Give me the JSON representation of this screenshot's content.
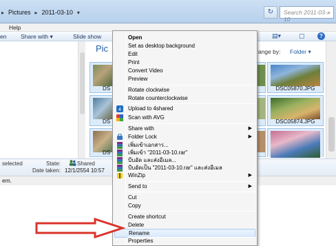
{
  "address": {
    "back_glyph": "▸",
    "crumbs": [
      "Pictures",
      "2011-03-10"
    ],
    "refresh_glyph": "↻",
    "search_placeholder": "Search 2011-03-10"
  },
  "menubar": {
    "help": "Help"
  },
  "toolbar": {
    "first_item": "en",
    "share_with": "Share with",
    "slide_show": "Slide show",
    "chevron": "▾"
  },
  "content": {
    "library_title_partial": "Pic",
    "arrange_label": "range by:",
    "arrange_value": "Folder",
    "thumbnails": [
      {
        "caption": "DS"
      },
      {
        "caption": "DS"
      },
      {
        "caption": "DS"
      },
      {
        "caption": "DSC05870.JPG"
      },
      {
        "caption": "DSC05874.JPG"
      },
      {
        "caption": ""
      }
    ]
  },
  "details": {
    "selected_text": "selected",
    "state_label": "State:",
    "state_value": "Shared",
    "date_label": "Date taken:",
    "date_value": "12/1/2554 10:57"
  },
  "status": {
    "text": "em."
  },
  "context_menu": {
    "items": [
      {
        "label": "Open",
        "bold": true
      },
      {
        "label": "Set as desktop background"
      },
      {
        "label": "Edit"
      },
      {
        "label": "Print"
      },
      {
        "label": "Convert Video"
      },
      {
        "label": "Preview"
      },
      {
        "label": "Rotate clockwise"
      },
      {
        "label": "Rotate counterclockwise"
      },
      {
        "label": "Upload to 4shared"
      },
      {
        "label": "Scan with AVG"
      },
      {
        "label": "Share with",
        "submenu": true
      },
      {
        "label": "Folder Lock",
        "submenu": true
      },
      {
        "label": "เพิ่มเข้าเอกสาร..."
      },
      {
        "label": "เพิ่มเข้า \"2011-03-10.rar\""
      },
      {
        "label": "บีบอัด และส่งอีเมล..."
      },
      {
        "label": "บีบอัดเป็น \"2011-03-10.rar\" และส่งอีเมล"
      },
      {
        "label": "WinZip",
        "submenu": true
      },
      {
        "label": "Send to",
        "submenu": true
      },
      {
        "label": "Cut"
      },
      {
        "label": "Copy"
      },
      {
        "label": "Create shortcut"
      },
      {
        "label": "Delete"
      },
      {
        "label": "Rename",
        "highlighted": true
      },
      {
        "label": "Properties"
      }
    ],
    "submenu_glyph": "▶"
  },
  "colors": {
    "accent_blue": "#1e5fa0",
    "arrow_red": "#d9342b",
    "menu_highlight": "#d9e9fb"
  }
}
